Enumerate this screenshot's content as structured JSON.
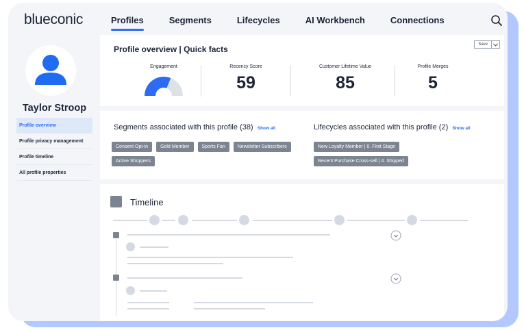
{
  "app": {
    "logo": "blueconic"
  },
  "nav": {
    "tabs": [
      {
        "label": "Profiles",
        "active": true
      },
      {
        "label": "Segments"
      },
      {
        "label": "Lifecycles"
      },
      {
        "label": "AI Workbench"
      },
      {
        "label": "Connections"
      }
    ]
  },
  "profile": {
    "name": "Taylor Stroop",
    "menu": [
      {
        "label": "Profile overview",
        "active": true
      },
      {
        "label": "Profile privacy management"
      },
      {
        "label": "Profile timeline"
      },
      {
        "label": "All profile properties"
      }
    ]
  },
  "overview": {
    "title": "Profile overview  |  Quick facts",
    "save_label": "Save",
    "metrics": {
      "engagement": {
        "label": "Engagement",
        "gauge_fraction": 0.62
      },
      "recency": {
        "label": "Recency Score",
        "value": "59"
      },
      "clv": {
        "label": "Customer Lifetime Value",
        "value": "85"
      },
      "merges": {
        "label": "Profile Merges",
        "value": "5"
      }
    }
  },
  "segments": {
    "title": "Segments associated with this profile (38)",
    "show_all": "Show all",
    "chips": [
      "Consent Opt-in",
      "Gold Member",
      "Sports Fan",
      "Newsletter Subscribers",
      "Active Shoppers"
    ]
  },
  "lifecycles": {
    "title": "Lifecycles associated with this profile (2)",
    "show_all": "Show all",
    "chips": [
      "New Loyalty Member  |  0. First Stage",
      "Recent Purchase Cross-sell  |  4. Shipped"
    ]
  },
  "timeline": {
    "title": "Timeline"
  },
  "colors": {
    "accent": "#2d6cf0",
    "chip": "#7c8491",
    "backdrop": "#b3c8ff",
    "avatar": "#1f6bf2"
  },
  "icons": {
    "search": "search-icon",
    "avatar": "person-icon",
    "expand": "chevron-down-icon"
  }
}
